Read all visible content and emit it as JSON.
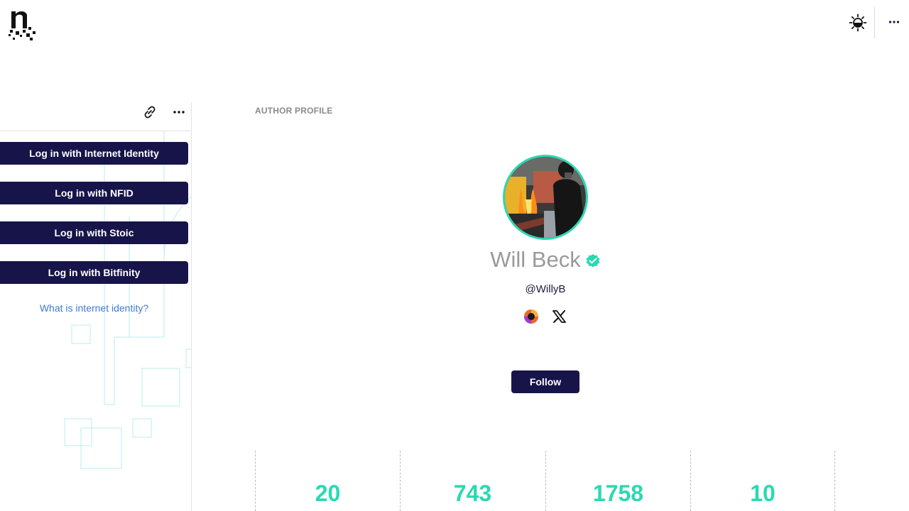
{
  "header": {
    "logo_icon": "nuance-logo",
    "theme_icon": "sun-gear-icon",
    "more_icon": "more-horizontal-icon"
  },
  "left_panel": {
    "toolbar": {
      "link_icon": "link-icon",
      "more_icon": "more-horizontal-icon"
    },
    "login_buttons": [
      "Log in with Internet Identity",
      "Log in with NFID",
      "Log in with Stoic",
      "Log in with Bitfinity"
    ],
    "help_link": "What is internet identity?"
  },
  "profile": {
    "section_label": "AUTHOR PROFILE",
    "name": "Will Beck",
    "verified_icon": "verified-badge-icon",
    "handle": "@WillyB",
    "social_links": [
      "internet-computer-icon",
      "x-twitter-icon"
    ],
    "follow_label": "Follow",
    "stats": [
      "20",
      "743",
      "1758",
      "10"
    ]
  },
  "colors": {
    "accent": "#2ad9b1",
    "button_bg": "#17144a",
    "link": "#3b7bd4",
    "muted_text": "#9a9a9a"
  }
}
